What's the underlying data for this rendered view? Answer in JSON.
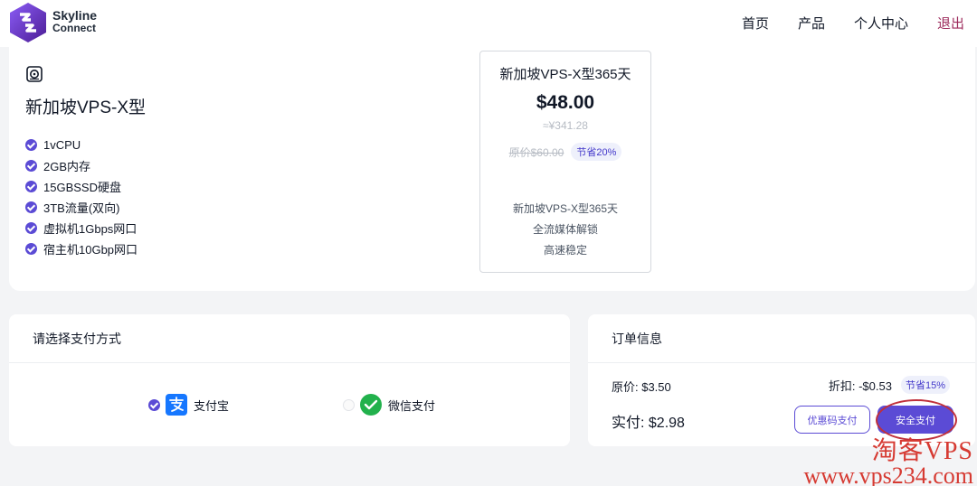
{
  "header": {
    "brand_line1": "Skyline",
    "brand_line2": "Connect",
    "nav": [
      "首页",
      "产品",
      "个人中心",
      "退出"
    ]
  },
  "product": {
    "icon": "server-icon",
    "title": "新加坡VPS-X型",
    "features": [
      "1vCPU",
      "2GB内存",
      "15GBSSD硬盘",
      "3TB流量(双向)",
      "虚拟机1Gbps网口",
      "宿主机10Gbp网口"
    ],
    "plan": {
      "name": "新加坡VPS-X型365天",
      "price": "$48.00",
      "cny": "≈¥341.28",
      "original": "原价$60.00",
      "save": "节省20%",
      "desc": [
        "新加坡VPS-X型365天",
        "全流媒体解锁",
        "高速稳定"
      ]
    }
  },
  "payment": {
    "title": "请选择支付方式",
    "options": [
      {
        "label": "支付宝",
        "icon": "alipay-icon",
        "selected": true
      },
      {
        "label": "微信支付",
        "icon": "wechat-icon",
        "selected": false
      }
    ]
  },
  "order": {
    "title": "订单信息",
    "original": "原价:  $3.50",
    "discount": "折扣:  -$0.53",
    "discount_badge": "节省15%",
    "total": "实付:  $2.98",
    "coupon_button": "优惠码支付",
    "pay_button": "安全支付"
  },
  "watermark": {
    "line1": "淘客VPS",
    "line2": "www.vps234.com"
  },
  "colors": {
    "accent": "#5b4bd5",
    "logout": "#9d2b5c",
    "watermark": "#d63a32"
  }
}
